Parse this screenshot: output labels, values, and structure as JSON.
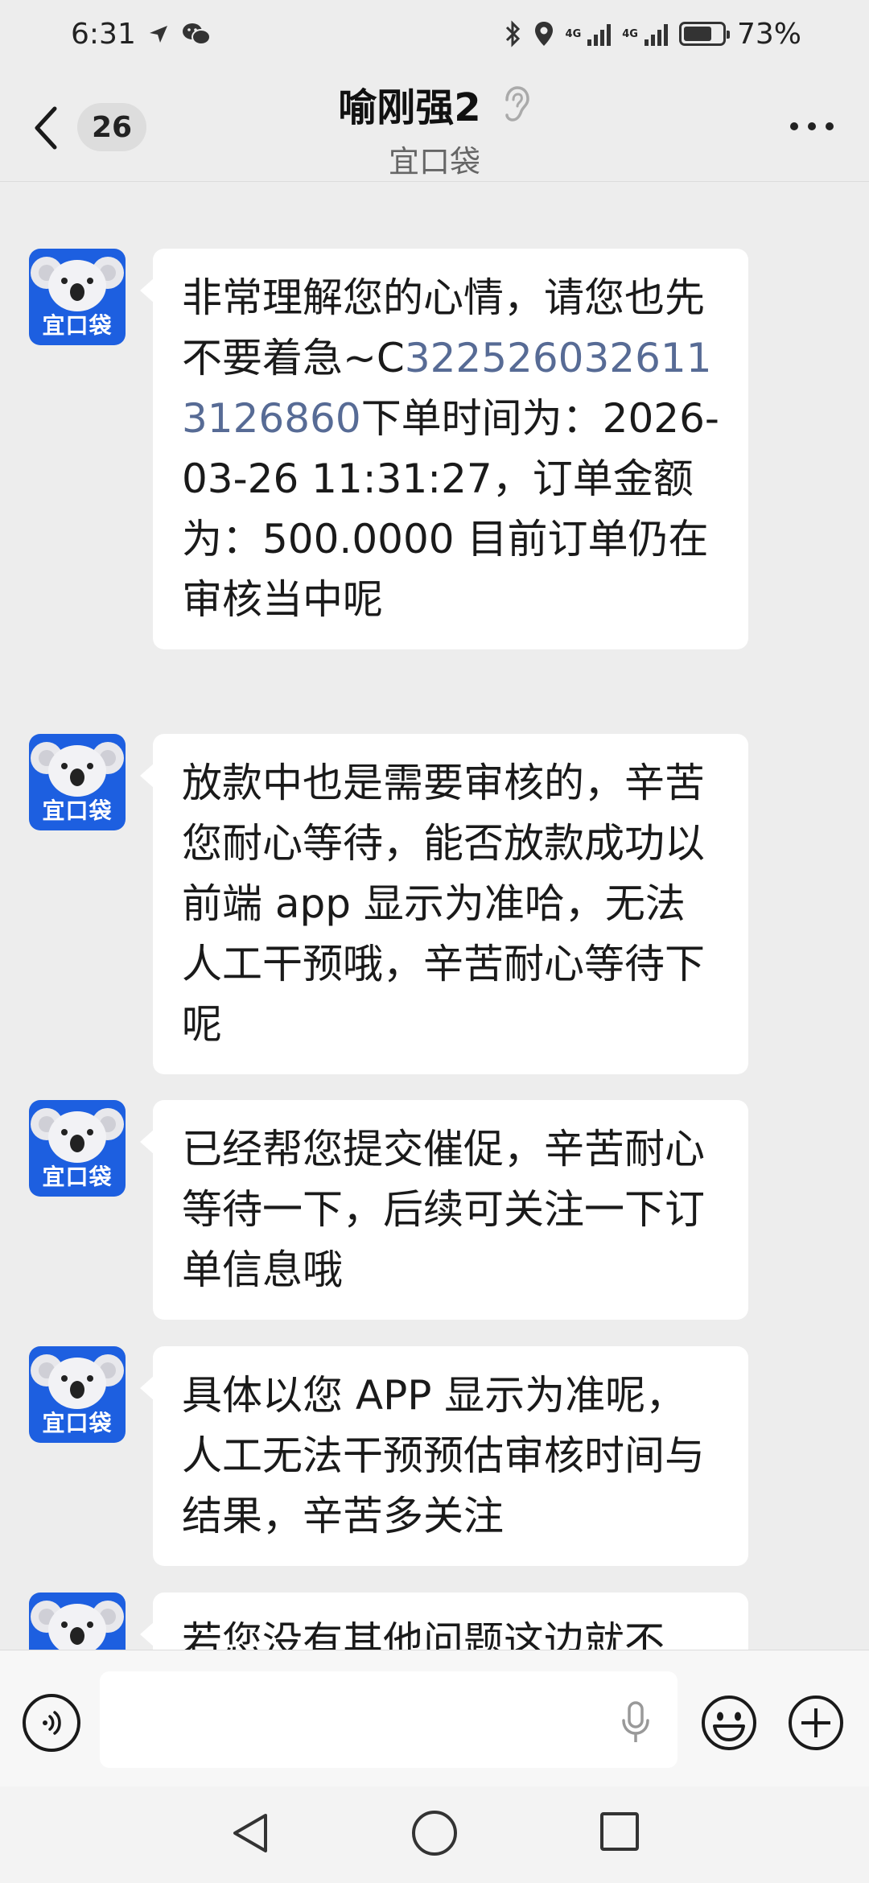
{
  "status_bar": {
    "time": "6:31",
    "network_left": "4G",
    "network_right": "4G",
    "battery_percent": "73%",
    "battery_level": 0.73,
    "icons": [
      "navigation-icon",
      "wechat-icon",
      "bluetooth-icon",
      "location-icon",
      "signal-icon",
      "signal-icon",
      "battery-icon"
    ]
  },
  "header": {
    "unread_count": "26",
    "title": "喻刚强2",
    "subtitle": "宜口袋",
    "icons": [
      "back-arrow-icon",
      "ear-icon",
      "more-icon"
    ]
  },
  "avatar": {
    "label": "宜口袋",
    "icon": "koala-icon",
    "bg_color": "#1d5fe0"
  },
  "messages": [
    {
      "id": "m1",
      "text_before": "非常理解您的心情，请您也先不要着急~C",
      "link": "3225260326113126860",
      "text_after": "下单时间为：2026-03-26 11:31:27，订单金额为：500.0000 目前订单仍在审核当中呢"
    },
    {
      "id": "m2",
      "text": "放款中也是需要审核的，辛苦您耐心等待，能否放款成功以前端 app 显示为准哈，无法人工干预哦，辛苦耐心等待下呢"
    },
    {
      "id": "m3",
      "text": "已经帮您提交催促，辛苦耐心等待一下，后续可关注一下订单信息哦"
    },
    {
      "id": "m4",
      "text": "具体以您 APP 显示为准呢，人工无法干预预估审核时间与结果，辛苦多关注"
    },
    {
      "id": "m5",
      "text": "若您没有其他问题这边就不"
    }
  ],
  "input_bar": {
    "placeholder": "",
    "icons": [
      "voice-icon",
      "mic-icon",
      "emoji-icon",
      "plus-icon"
    ]
  },
  "nav_bar": {
    "icons": [
      "nav-back-icon",
      "nav-home-icon",
      "nav-recent-icon"
    ]
  },
  "colors": {
    "background": "#ededed",
    "bubble": "#ffffff",
    "link": "#576b95",
    "avatar_bg": "#1d5fe0"
  }
}
